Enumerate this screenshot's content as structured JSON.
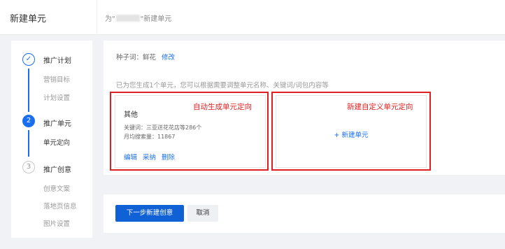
{
  "header": {
    "title": "新建单元",
    "crumb_prefix": "为\"",
    "crumb_suffix": "\"新建单元"
  },
  "steps": [
    {
      "index": "✓",
      "label": "推广计划",
      "subs": [
        "营销目标",
        "计划设置"
      ],
      "state": "done"
    },
    {
      "index": "2",
      "label": "推广单元",
      "subs": [
        "单元定向"
      ],
      "state": "active"
    },
    {
      "index": "3",
      "label": "推广创意",
      "subs": [
        "创意文案",
        "落地页信息",
        "图片设置"
      ],
      "state": "todo"
    }
  ],
  "seed": {
    "label": "种子词：鲜花",
    "edit": "修改"
  },
  "hint": "已为您生成1个单元，您可以根据需要调整单元名称、关键词/词包内容等",
  "unit_card": {
    "name": "其他",
    "keywords": "关键词：三亚送花花店等286个",
    "volume": "月均搜索量：11867",
    "actions": {
      "edit": "编辑",
      "adopt": "采纳",
      "delete": "删除"
    }
  },
  "custom_card": {
    "add": "+ 新建单元"
  },
  "annotations": {
    "auto": "自动生成单元定向",
    "custom": "新建自定义单元定向"
  },
  "footer": {
    "next": "下一步新建创意",
    "cancel": "取消"
  },
  "colors": {
    "accent": "#1a6ff0",
    "annotation": "#e02020"
  }
}
